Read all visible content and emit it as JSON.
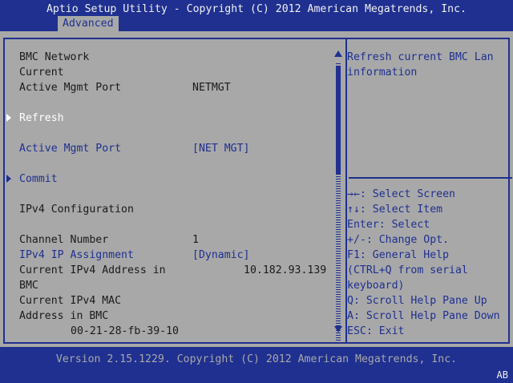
{
  "header": {
    "title": "Aptio Setup Utility - Copyright (C) 2012 American Megatrends, Inc.",
    "tab": "Advanced"
  },
  "left": {
    "bmc_network": "BMC Network",
    "current": "Current",
    "active_mgmt_port_label": "Active Mgmt Port",
    "active_mgmt_port_value": "NETMGT",
    "refresh": "Refresh",
    "active_mgmt_port_setting": "Active Mgmt Port",
    "active_mgmt_port_setting_value": "[NET MGT]",
    "commit": "Commit",
    "ipv4_configuration": "IPv4 Configuration",
    "channel_number_label": "Channel Number",
    "channel_number_value": "1",
    "ipv4_ip_assignment_label": "IPv4 IP Assignment",
    "ipv4_ip_assignment_value": "[Dynamic]",
    "current_ipv4_addr_line1": "Current IPv4 Address in",
    "current_ipv4_addr_line2": "BMC",
    "current_ipv4_addr_value": "10.182.93.139",
    "current_ipv4_mac_line1": "Current IPv4 MAC",
    "current_ipv4_mac_line2": "Address in BMC",
    "current_ipv4_mac_value": "00-21-28-fb-39-10"
  },
  "right": {
    "help_line1": "Refresh current BMC Lan",
    "help_line2": "information",
    "keys": [
      "→←: Select Screen",
      "↑↓: Select Item",
      "Enter: Select",
      "+/-: Change Opt.",
      "F1: General Help",
      "(CTRL+Q from serial",
      "keyboard)",
      "Q: Scroll Help Pane Up",
      "A: Scroll Help Pane Down",
      "ESC: Exit"
    ]
  },
  "footer": {
    "version": "Version 2.15.1229. Copyright (C) 2012 American Megatrends, Inc.",
    "corner": "AB"
  },
  "colors": {
    "background": "#1f3090",
    "panel": "#a8a8a8",
    "highlight": "#ffffff",
    "text": "#1a1a1a"
  }
}
